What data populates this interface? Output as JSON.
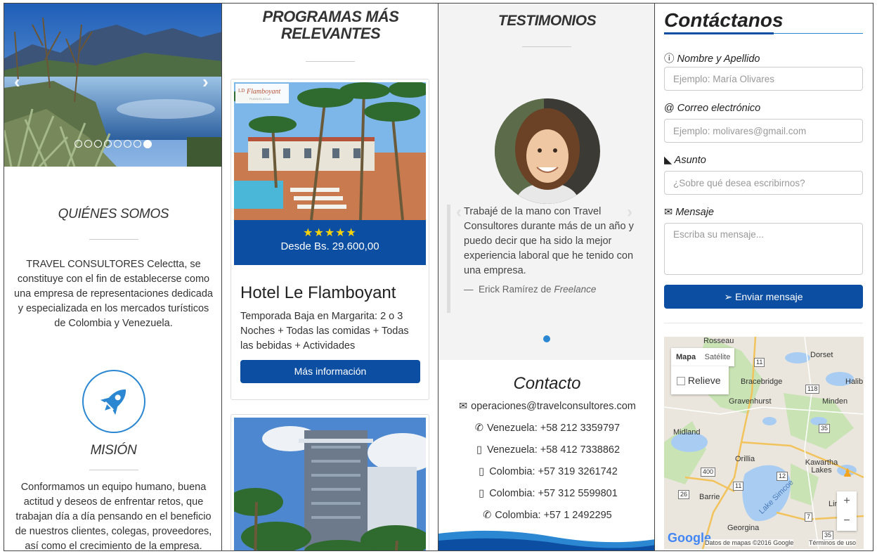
{
  "panel1": {
    "carousel": {
      "dot_count": 8,
      "active_dot": 7
    },
    "about": {
      "title": "QUIÉNES SOMOS",
      "text": "TRAVEL CONSULTORES Celectta, se constituye con el fin de establecerse como una empresa de representaciones dedicada y especializada en los mercados turísticos de Colombia y Venezuela."
    },
    "mission": {
      "title": "MISIÓN",
      "text": "Conformamos un equipo humano, buena actitud y deseos de enfrentar retos, que trabajan día a día pensando en el beneficio de nuestros clientes, colegas, proveedores, así como el crecimiento de la empresa."
    }
  },
  "panel2": {
    "title": "PROGRAMAS MÁS RELEVANTES",
    "card1": {
      "logo_text": "Flamboyant",
      "logo_sub": "PLAYA EL AGUA",
      "stars": "★★★★★",
      "price": "Desde Bs. 29.600,00",
      "name": "Hotel Le Flamboyant",
      "description": "Temporada Baja en Margarita: 2 o 3 Noches + Todas las comidas + Todas las bebidas + Actividades",
      "button": "Más información"
    }
  },
  "panel3": {
    "title": "TESTIMONIOS",
    "testimonial": {
      "text": "Trabajé de la mano con Travel Consultores durante más de un año y puedo decir que ha sido la mejor experiencia laboral que he tenido con una empresa.",
      "dash": "—",
      "author": "Erick Ramírez",
      "connector": "de",
      "role": "Freelance"
    },
    "contact": {
      "title": "Contacto",
      "email": "operaciones@travelconsultores.com",
      "phones": [
        {
          "icon": "phone-icon",
          "text": "Venezuela: +58 212 3359797"
        },
        {
          "icon": "mobile-icon",
          "text": "Venezuela: +58 412 7338862"
        },
        {
          "icon": "mobile-icon",
          "text": "Colombia: +57 319 3261742"
        },
        {
          "icon": "mobile-icon",
          "text": "Colombia: +57 312 5599801"
        },
        {
          "icon": "phone-icon",
          "text": "Colombia: +57 1 2492295"
        }
      ]
    }
  },
  "panel4": {
    "title": "Contáctanos",
    "form": {
      "name_label": "Nombre y Apellido",
      "name_placeholder": "Ejemplo: María Olivares",
      "email_label": "Correo electrónico",
      "email_prefix": "@",
      "email_placeholder": "Ejemplo: molivares@gmail.com",
      "subject_label": "Asunto",
      "subject_placeholder": "¿Sobre qué desea escribirnos?",
      "message_label": "Mensaje",
      "message_placeholder": "Escriba su mensaje...",
      "submit": "Enviar mensaje"
    },
    "map": {
      "tab_map": "Mapa",
      "tab_satellite": "Satélite",
      "relief": "Relieve",
      "places": [
        "Rosseau",
        "Dorset",
        "Bracebridge",
        "Halib",
        "Gravenhurst",
        "Minden",
        "Midland",
        "Orillia",
        "Kawartha Lakes",
        "Barrie",
        "Lake Simcoe",
        "Linds",
        "Georgina"
      ],
      "routes": [
        "11",
        "118",
        "35",
        "12",
        "400",
        "11",
        "26",
        "7",
        "35"
      ],
      "zoom_in": "+",
      "zoom_out": "−",
      "google": "Google",
      "attribution": "Datos de mapas ©2016 Google",
      "terms": "Términos de uso"
    },
    "colors": {
      "brand_blue": "#0b4ea2",
      "accent_blue": "#2b87d1",
      "star_yellow": "#f5d20c"
    }
  }
}
